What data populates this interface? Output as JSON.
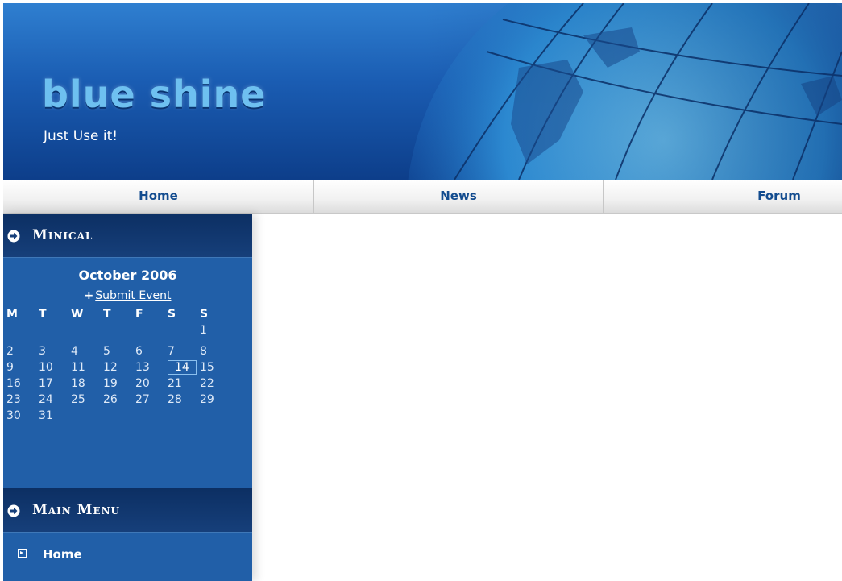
{
  "header": {
    "title": "blue shine",
    "tagline": "Just Use it!"
  },
  "nav": {
    "items": [
      {
        "label": "Home"
      },
      {
        "label": "News"
      },
      {
        "label": "Forum"
      }
    ]
  },
  "sidebar": {
    "minical": {
      "title": "Minical",
      "month": "October 2006",
      "submit_label": "Submit Event",
      "weekdays": [
        "M",
        "T",
        "W",
        "T",
        "F",
        "S",
        "S"
      ],
      "weeks": [
        [
          "",
          "",
          "",
          "",
          "",
          "",
          "1"
        ],
        [
          "2",
          "3",
          "4",
          "5",
          "6",
          "7",
          "8"
        ],
        [
          "9",
          "10",
          "11",
          "12",
          "13",
          "14",
          "15"
        ],
        [
          "16",
          "17",
          "18",
          "19",
          "20",
          "21",
          "22"
        ],
        [
          "23",
          "24",
          "25",
          "26",
          "27",
          "28",
          "29"
        ],
        [
          "30",
          "31",
          "",
          "",
          "",
          "",
          ""
        ]
      ],
      "today": "14"
    },
    "main_menu": {
      "title": "Main Menu",
      "items": [
        {
          "label": "Home"
        }
      ]
    }
  },
  "colors": {
    "header_top": "#2f7fd0",
    "header_bottom": "#0d3e8a",
    "sidebar_bg": "#215fa8",
    "nav_text": "#134c8f"
  }
}
